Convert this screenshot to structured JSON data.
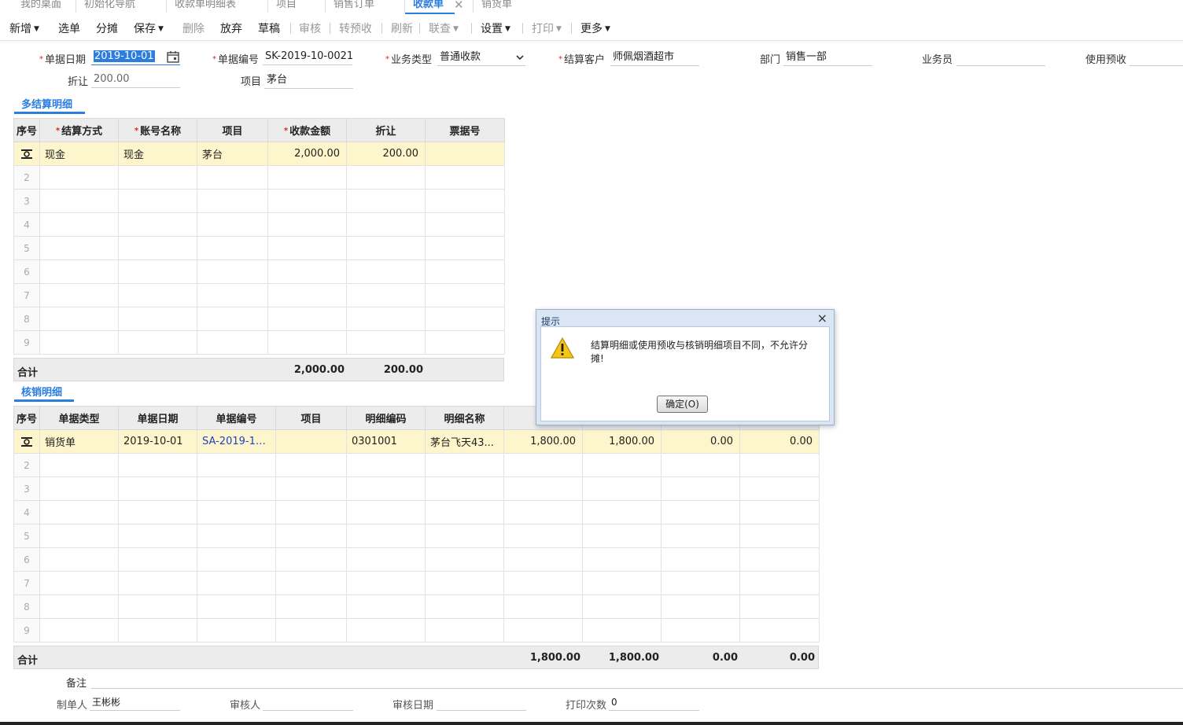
{
  "tabs": [
    {
      "label": "我的桌面"
    },
    {
      "label": "初始化导航"
    },
    {
      "label": "收款单明细表"
    },
    {
      "label": "项目"
    },
    {
      "label": "销售订单"
    },
    {
      "label": "收款单"
    },
    {
      "label": "销货单"
    }
  ],
  "toolbar": {
    "add": "新增",
    "select": "选单",
    "allocate": "分摊",
    "save": "保存",
    "delete": "删除",
    "discard": "放弃",
    "draft": "草稿",
    "audit": "审核",
    "to_prepay": "转预收",
    "refresh": "刷新",
    "linked": "联查",
    "settings": "设置",
    "print": "打印",
    "more": "更多"
  },
  "form": {
    "date_label": "单据日期",
    "date_value": "2019-10-01",
    "no_label": "单据编号",
    "no_value": "SK-2019-10-0021",
    "biz_type_label": "业务类型",
    "biz_type_value": "普通收款",
    "customer_label": "结算客户",
    "customer_value": "师佩烟酒超市",
    "dept_label": "部门",
    "dept_value": "销售一部",
    "salesman_label": "业务员",
    "salesman_value": "",
    "use_prepay_label": "使用预收",
    "use_prepay_value": "",
    "discount_label": "折让",
    "discount_value": "200.00",
    "project_label": "项目",
    "project_value": "茅台"
  },
  "settlement": {
    "title": "多结算明细",
    "headers": [
      "序号",
      "结算方式",
      "账号名称",
      "项目",
      "收款金额",
      "折让",
      "票据号"
    ],
    "rows": [
      {
        "method": "现金",
        "account": "现金",
        "project": "茅台",
        "amount": "2,000.00",
        "discount": "200.00",
        "bill_no": ""
      }
    ],
    "row_numbers": [
      "2",
      "3",
      "4",
      "5",
      "6",
      "7",
      "8",
      "9"
    ],
    "total_label": "合计",
    "total_amount": "2,000.00",
    "total_discount": "200.00"
  },
  "writeoff": {
    "title": "核销明细",
    "headers": [
      "序号",
      "单据类型",
      "单据日期",
      "单据编号",
      "项目",
      "明细编码",
      "明细名称"
    ],
    "rows": [
      {
        "type": "销货单",
        "date": "2019-10-01",
        "doc_no": "SA-2019-10-...",
        "project": "",
        "item_code": "0301001",
        "item_name": "茅台飞天43...",
        "c1": "1,800.00",
        "c2": "1,800.00",
        "c3": "0.00",
        "c4": "0.00"
      }
    ],
    "row_numbers": [
      "2",
      "3",
      "4",
      "5",
      "6",
      "7",
      "8",
      "9"
    ],
    "total_label": "合计",
    "totals": [
      "1,800.00",
      "1,800.00",
      "0.00",
      "0.00"
    ]
  },
  "footer": {
    "remark_label": "备注",
    "remark_value": "",
    "maker_label": "制单人",
    "maker_value": "王彬彬",
    "auditor_label": "审核人",
    "auditor_value": "",
    "audit_date_label": "审核日期",
    "audit_date_value": "",
    "print_count_label": "打印次数",
    "print_count_value": "0"
  },
  "dialog": {
    "title": "提示",
    "message": "结算明细或使用预收与核销明细项目不同，不允许分摊!",
    "ok_label": "确定(O)"
  },
  "colors": {
    "accent": "#2b7de0",
    "highlight_row": "#fdf5cc",
    "header_bg": "#ececec"
  }
}
